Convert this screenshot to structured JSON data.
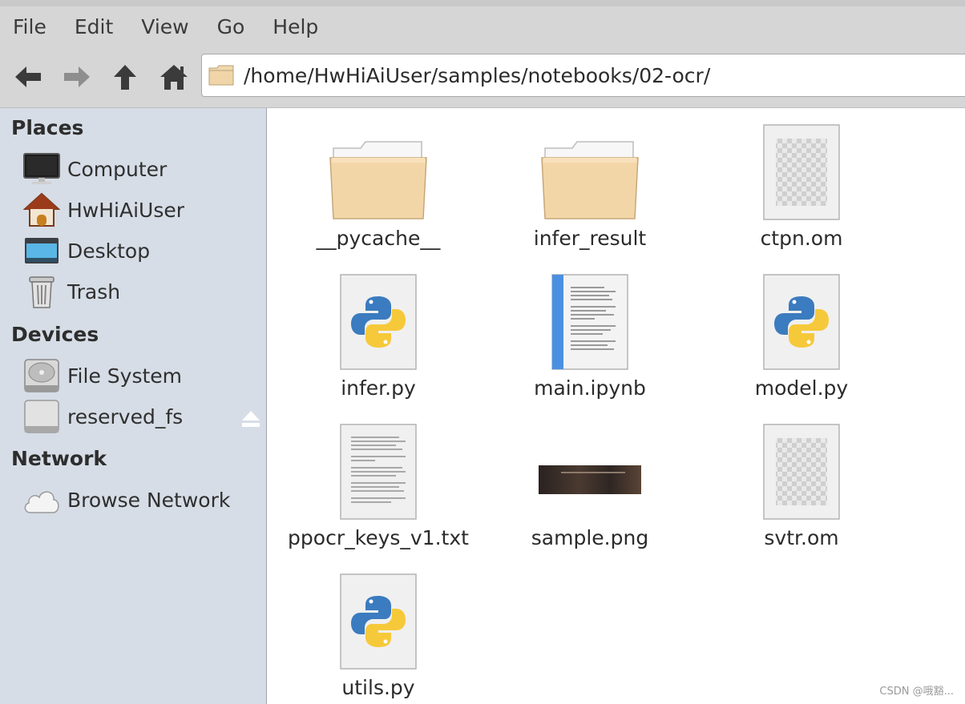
{
  "menubar": {
    "items": [
      "File",
      "Edit",
      "View",
      "Go",
      "Help"
    ]
  },
  "toolbar": {
    "back_icon": "arrow-left-icon",
    "forward_icon": "arrow-right-icon",
    "up_icon": "arrow-up-icon",
    "home_icon": "home-icon",
    "location_path": "/home/HwHiAiUser/samples/notebooks/02-ocr/"
  },
  "sidebar": {
    "places_title": "Places",
    "places": [
      {
        "label": "Computer",
        "icon": "computer-icon"
      },
      {
        "label": "HwHiAiUser",
        "icon": "home-folder-icon"
      },
      {
        "label": "Desktop",
        "icon": "desktop-icon"
      },
      {
        "label": "Trash",
        "icon": "trash-icon"
      }
    ],
    "devices_title": "Devices",
    "devices": [
      {
        "label": "File System",
        "icon": "harddisk-icon"
      },
      {
        "label": "reserved_fs",
        "icon": "drive-icon"
      }
    ],
    "network_title": "Network",
    "network": [
      {
        "label": "Browse Network",
        "icon": "cloud-icon"
      }
    ]
  },
  "files": [
    {
      "name": "__pycache__",
      "type": "folder"
    },
    {
      "name": "infer_result",
      "type": "folder"
    },
    {
      "name": "ctpn.om",
      "type": "binary"
    },
    {
      "name": "infer.py",
      "type": "python"
    },
    {
      "name": "main.ipynb",
      "type": "notebook"
    },
    {
      "name": "model.py",
      "type": "python"
    },
    {
      "name": "ppocr_keys_v1.txt",
      "type": "text"
    },
    {
      "name": "sample.png",
      "type": "image"
    },
    {
      "name": "svtr.om",
      "type": "binary"
    },
    {
      "name": "utils.py",
      "type": "python"
    }
  ],
  "watermark": "CSDN @哦豁..."
}
